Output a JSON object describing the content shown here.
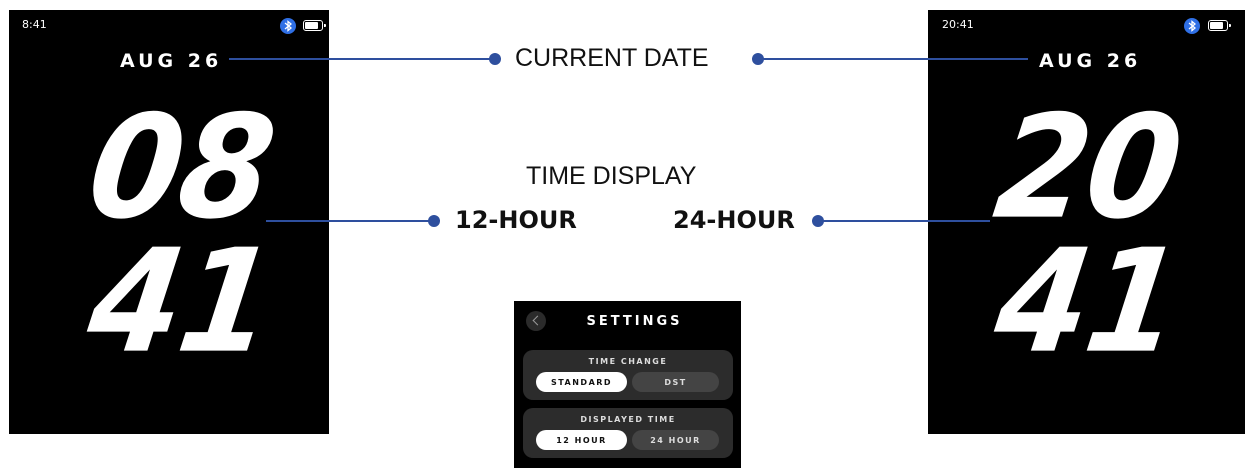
{
  "left_phone": {
    "status_time": "8:41",
    "date": "AUG 26",
    "hours": "08",
    "minutes": "41",
    "icons": [
      "bluetooth-icon",
      "battery-icon"
    ]
  },
  "right_phone": {
    "status_time": "20:41",
    "date": "AUG 26",
    "hours": "20",
    "minutes": "41",
    "icons": [
      "bluetooth-icon",
      "battery-icon"
    ]
  },
  "callouts": {
    "current_date": "CURRENT DATE",
    "time_display": "TIME DISPLAY",
    "hour_12": "12-HOUR",
    "hour_24": "24-HOUR"
  },
  "settings": {
    "title": "SETTINGS",
    "time_change": {
      "label": "TIME CHANGE",
      "options": [
        "STANDARD",
        "DST"
      ],
      "selected": "STANDARD"
    },
    "displayed_time": {
      "label": "DISPLAYED TIME",
      "options": [
        "12 HOUR",
        "24 HOUR"
      ],
      "selected": "12 HOUR"
    }
  },
  "colors": {
    "accent_line": "#2e4f9e",
    "bluetooth": "#2f6fe5",
    "screen_bg": "#000000"
  }
}
